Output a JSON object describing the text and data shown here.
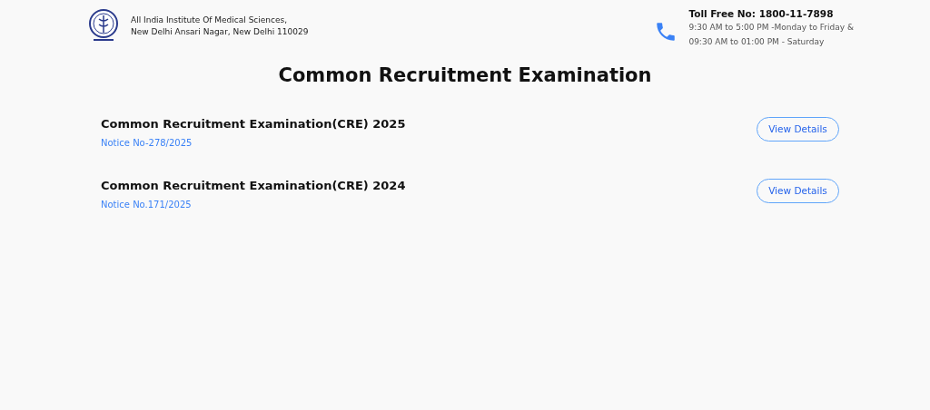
{
  "header": {
    "institute_lines": [
      "All India Institute Of Medical Sciences,",
      "New Delhi Ansari Nagar, New Delhi 110029"
    ],
    "toll_free": "Toll Free No: 1800-11-7898",
    "hours": [
      "9:30 AM to 5:00 PM -Monday to Friday &",
      "09:30 AM to 01:00 PM - Saturday"
    ]
  },
  "title": "Common Recruitment Examination",
  "exams": [
    {
      "name": "Common Recruitment Examination(CRE) 2025",
      "notice": "Notice No-278/2025",
      "button": "View Details"
    },
    {
      "name": "Common Recruitment Examination(CRE) 2024",
      "notice": "Notice No.171/2025",
      "button": "View Details"
    }
  ]
}
